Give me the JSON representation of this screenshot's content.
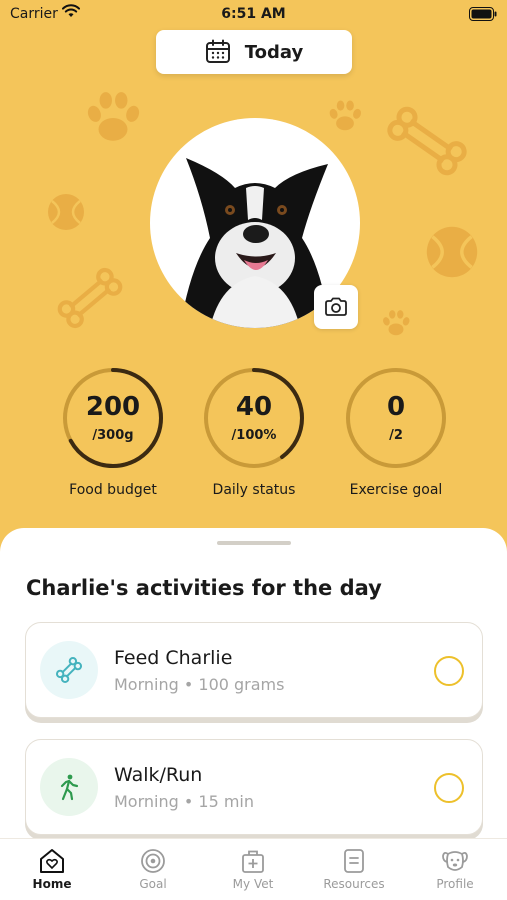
{
  "status_bar": {
    "carrier": "Carrier",
    "time": "6:51 AM"
  },
  "header": {
    "date_button_label": "Today"
  },
  "pet": {
    "name": "Charlie"
  },
  "stats": [
    {
      "value": "200",
      "sub": "/300g",
      "caption": "Food budget",
      "progress": 0.67
    },
    {
      "value": "40",
      "sub": "/100%",
      "caption": "Daily status",
      "progress": 0.4
    },
    {
      "value": "0",
      "sub": "/2",
      "caption": "Exercise goal",
      "progress": 0
    }
  ],
  "activities": {
    "title": "Charlie's activities for the day",
    "items": [
      {
        "title": "Feed Charlie",
        "meta": "Morning • 100 grams",
        "icon": "bone-icon",
        "bubble_color": "#E9F7F8",
        "icon_color": "#45B3BE"
      },
      {
        "title": "Walk/Run",
        "meta": "Morning • 15 min",
        "icon": "walking-person-icon",
        "bubble_color": "#E9F6EC",
        "icon_color": "#2E9A4E"
      }
    ]
  },
  "tabbar": {
    "tabs": [
      {
        "label": "Home",
        "icon": "home-heart-icon",
        "active": true
      },
      {
        "label": "Goal",
        "icon": "target-icon",
        "active": false
      },
      {
        "label": "My Vet",
        "icon": "medical-bag-icon",
        "active": false
      },
      {
        "label": "Resources",
        "icon": "document-icon",
        "active": false
      },
      {
        "label": "Profile",
        "icon": "dog-face-icon",
        "active": false
      }
    ]
  },
  "colors": {
    "background": "#F4C55A",
    "ring_track": "#C99A38",
    "ring_progress": "#3B2A12",
    "check_outline": "#EDC02B"
  }
}
